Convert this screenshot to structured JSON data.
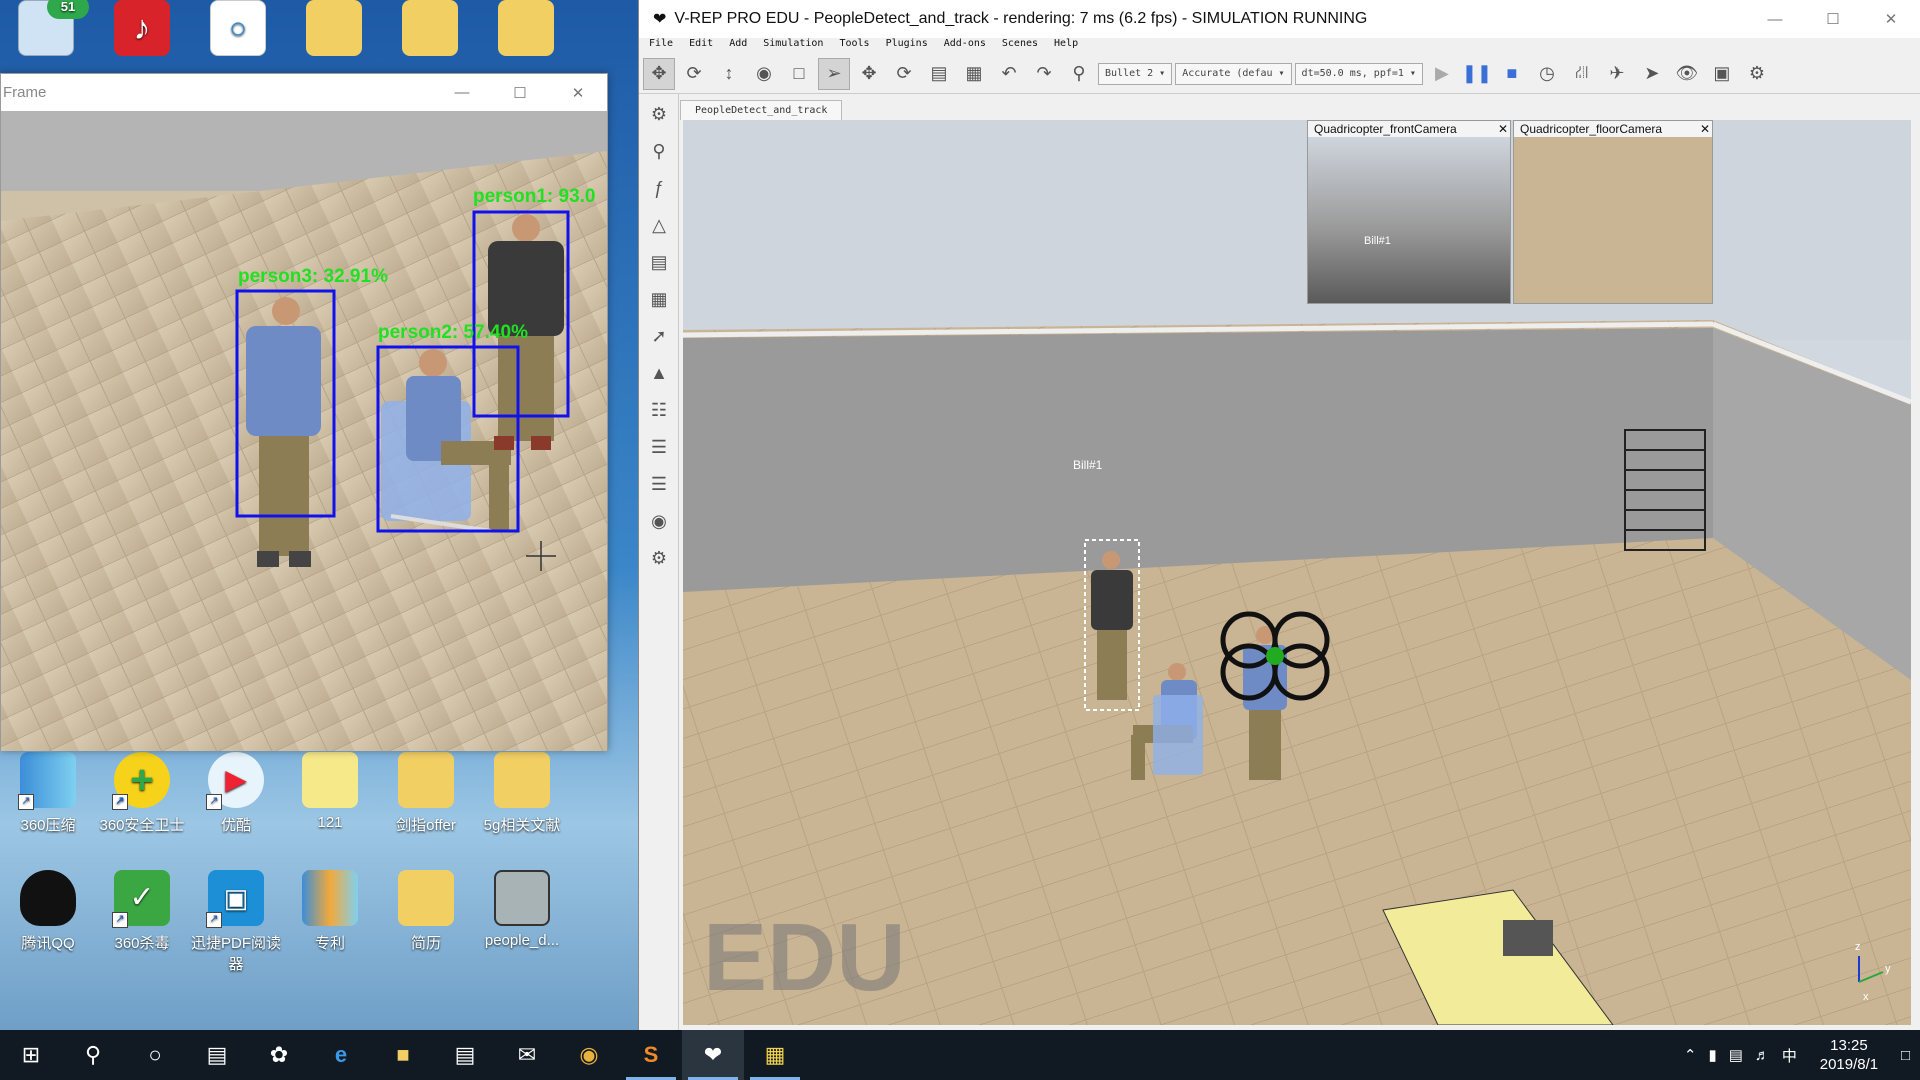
{
  "desktop": {
    "top_icons": [
      {
        "label": "",
        "icon": "recycle-bin-icon",
        "badge": "51"
      },
      {
        "label": "",
        "icon": "netease-music-icon"
      },
      {
        "label": "",
        "icon": "network-app-icon"
      },
      {
        "label": "",
        "icon": "maps-folder-icon"
      },
      {
        "label": "",
        "icon": "book-icon"
      },
      {
        "label": "",
        "icon": "folder-icon"
      }
    ],
    "row1": [
      {
        "label": "360压缩",
        "icon": "archive-icon"
      },
      {
        "label": "360安全卫士",
        "icon": "shield-plus-icon"
      },
      {
        "label": "优酷",
        "icon": "youku-icon"
      },
      {
        "label": "121",
        "icon": "document-icon"
      },
      {
        "label": "剑指offer",
        "icon": "folder-icon"
      },
      {
        "label": "5g相关文献",
        "icon": "book-folder-icon"
      }
    ],
    "row2": [
      {
        "label": "腾讯QQ",
        "icon": "qq-penguin-icon"
      },
      {
        "label": "360杀毒",
        "icon": "antivirus-shield-icon"
      },
      {
        "label": "迅捷PDF阅读器",
        "icon": "pdf-reader-icon"
      },
      {
        "label": "专利",
        "icon": "archive-icon"
      },
      {
        "label": "简历",
        "icon": "document-folder-icon"
      },
      {
        "label": "people_d...",
        "icon": "video-thumbnail-icon"
      }
    ]
  },
  "frame_window": {
    "title": "Frame",
    "detections": [
      {
        "label": "person1: 93.0",
        "box": "standing-dark"
      },
      {
        "label": "person2: 57.40%",
        "box": "seated"
      },
      {
        "label": "person3: 32.91%",
        "box": "standing-blue"
      }
    ]
  },
  "vrep": {
    "title": "V-REP PRO EDU - PeopleDetect_and_track - rendering: 7 ms (6.2 fps) - SIMULATION RUNNING",
    "menu": [
      "File",
      "Edit",
      "Add",
      "Simulation",
      "Tools",
      "Plugins",
      "Add-ons",
      "Scenes",
      "Help"
    ],
    "engine_select": "Bullet 2",
    "accuracy_select": "Accurate (defau",
    "timestep_select": "dt=50.0 ms, ppf=1",
    "scene_tab": "PeopleDetect_and_track",
    "cam_front": "Quadricopter_frontCamera",
    "cam_floor": "Quadricopter_floorCamera",
    "bill_label": "Bill#1",
    "watermark": "EDU",
    "axis_labels": {
      "z": "z",
      "y": "y",
      "x": "x"
    }
  },
  "taskbar": {
    "time": "13:25",
    "date": "2019/8/1",
    "ime": "中"
  }
}
